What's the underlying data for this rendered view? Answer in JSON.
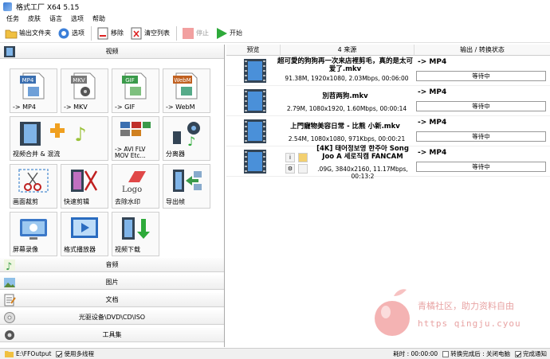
{
  "window": {
    "title": "格式工厂 X64 5.15"
  },
  "menu": [
    "任务",
    "皮肤",
    "语言",
    "选项",
    "帮助"
  ],
  "toolbar": {
    "output_folder": "输出文件夹",
    "options": "选项",
    "remove": "移除",
    "clear_list": "清空列表",
    "stop": "停止",
    "start": "开始"
  },
  "categories": {
    "video": "视频",
    "audio": "音频",
    "picture": "图片",
    "document": "文档",
    "optical": "光驱设备\\DVD\\CD\\ISO",
    "tools": "工具集"
  },
  "video_tiles": [
    {
      "label": "-> MP4",
      "badge": "MP4"
    },
    {
      "label": "-> MKV",
      "badge": "MKV"
    },
    {
      "label": "-> GIF",
      "badge": "GIF"
    },
    {
      "label": "-> WebM",
      "badge": "WebM"
    },
    {
      "label": "视频合并 & 混流",
      "badge": ""
    },
    {
      "label": "-> AVI FLV MOV Etc...",
      "badge": ""
    },
    {
      "label": "分离器",
      "badge": ""
    },
    {
      "label": "画面裁剪",
      "badge": ""
    },
    {
      "label": "快速剪辑",
      "badge": ""
    },
    {
      "label": "去除水印",
      "badge": "Logo"
    },
    {
      "label": "导出帧",
      "badge": ""
    },
    {
      "label": "屏幕录像",
      "badge": ""
    },
    {
      "label": "格式播放器",
      "badge": ""
    },
    {
      "label": "视频下载",
      "badge": ""
    }
  ],
  "columns": {
    "preview": "预览",
    "source": "4 来源",
    "output_status": "输出 / 转换状态"
  },
  "tasks": [
    {
      "name": "超可愛的狗狗再一次来店裡剪毛，真的是太可爱了.mkv",
      "info": "91.38M, 1920x1080, 2.03Mbps, 00:06:00",
      "output": "-> MP4",
      "status": "等待中"
    },
    {
      "name": "別苕两狗.mkv",
      "info": "2.79M, 1080x1920, 1.60Mbps, 00:00:14",
      "output": "-> MP4",
      "status": "等待中"
    },
    {
      "name": "上門寵物美容日常 - 比熊 小新.mkv",
      "info": "2.54M, 1080x1080, 971Kbps, 00:00:21",
      "output": "-> MP4",
      "status": "等待中"
    },
    {
      "name": "[4K] 태어정보영 한주아 Song Joo A 세로직캠 FANCAM",
      "info": ".09G, 3840x2160, 11.17Mbps, 00:13:2",
      "output": "-> MP4",
      "status": "等待中"
    }
  ],
  "status_bar": {
    "output_path": "E:\\FFOutput",
    "multithread": "使用多线程",
    "elapsed": "耗时 : 00:00:00",
    "after_done": "转换完成后 : 关闭电脑",
    "notify": "完成通知"
  },
  "watermark": {
    "line1": "青橘社区，助力资料自由",
    "line2": "https  qingju.cyou"
  }
}
